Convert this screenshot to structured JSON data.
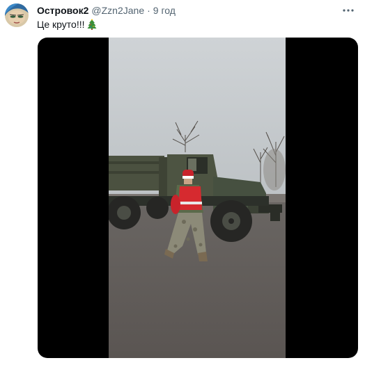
{
  "tweet": {
    "display_name": "Островок2",
    "handle": "@Zzn2Jane",
    "separator": "·",
    "time": "9 год",
    "text": "Це круто!!!",
    "emoji_icon": "christmas-tree-icon",
    "more_icon": "more-options-icon"
  },
  "colors": {
    "text_primary": "#0f1419",
    "text_secondary": "#536471",
    "media_background": "#000000"
  }
}
